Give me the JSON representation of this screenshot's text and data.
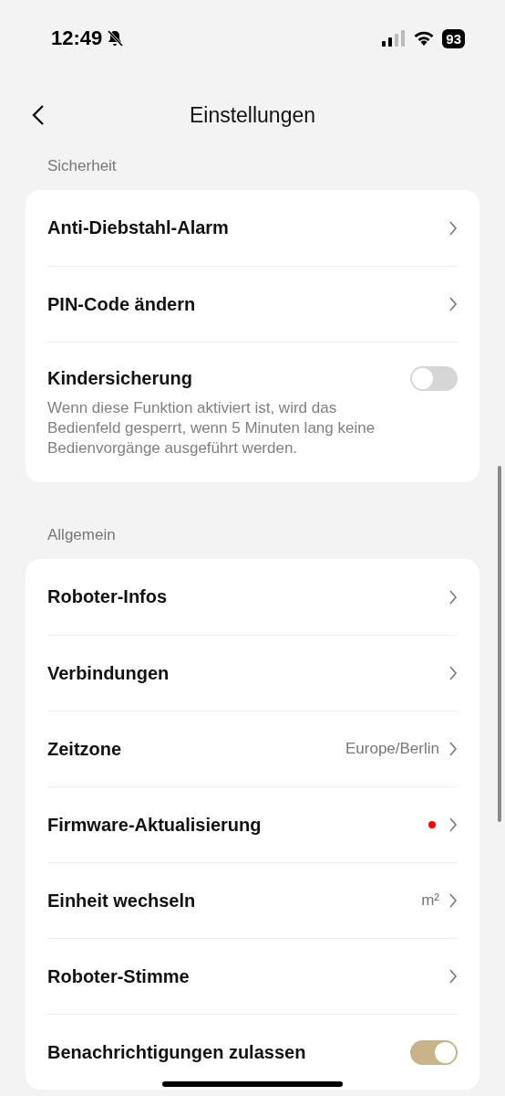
{
  "status_bar": {
    "time": "12:49",
    "battery": "93"
  },
  "nav": {
    "title": "Einstellungen"
  },
  "sections": [
    {
      "title": "Sicherheit",
      "items": [
        {
          "kind": "link",
          "label": "Anti-Diebstahl-Alarm"
        },
        {
          "kind": "link",
          "label": "PIN-Code ändern"
        },
        {
          "kind": "toggle",
          "label": "Kindersicherung",
          "on": false,
          "description": "Wenn diese Funktion aktiviert ist, wird das Bedienfeld gesperrt, wenn 5 Minuten lang keine Bedienvorgänge ausgeführt werden."
        }
      ]
    },
    {
      "title": "Allgemein",
      "items": [
        {
          "kind": "link",
          "label": "Roboter-Infos"
        },
        {
          "kind": "link",
          "label": "Verbindungen"
        },
        {
          "kind": "link",
          "label": "Zeitzone",
          "value": "Europe/Berlin"
        },
        {
          "kind": "link",
          "label": "Firmware-Aktualisierung",
          "badge": true
        },
        {
          "kind": "link",
          "label": "Einheit wechseln",
          "value": "m²"
        },
        {
          "kind": "link",
          "label": "Roboter-Stimme"
        },
        {
          "kind": "toggle",
          "label": "Benachrichtigungen zulassen",
          "on": true
        }
      ]
    }
  ]
}
